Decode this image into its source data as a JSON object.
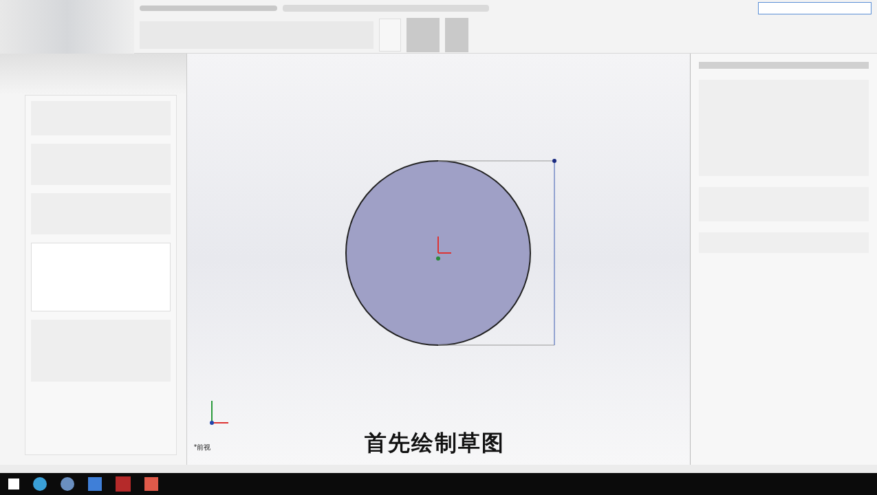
{
  "graphics": {
    "view_label": "*前视",
    "caption": "首先绘制草图"
  }
}
